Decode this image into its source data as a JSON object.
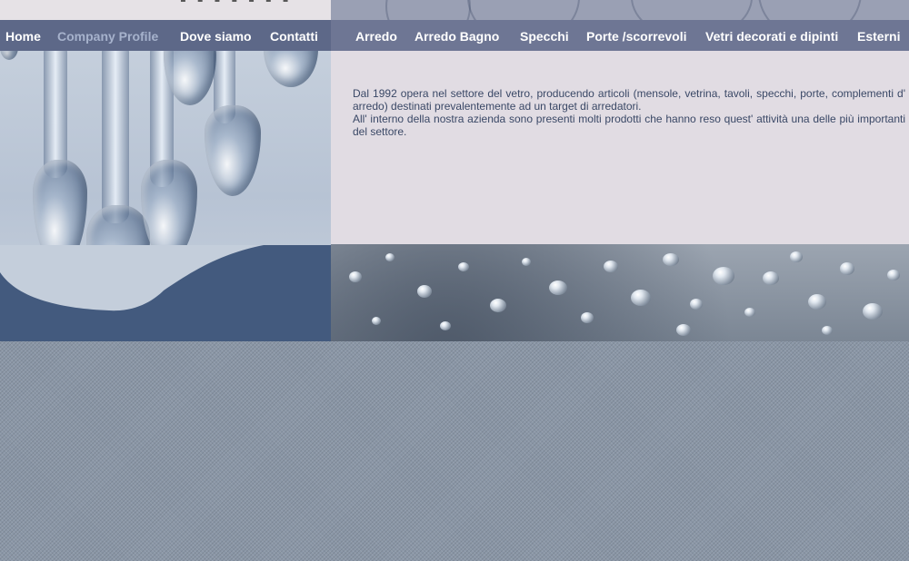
{
  "nav": {
    "left": [
      {
        "label": "Home",
        "current": false
      },
      {
        "label": "Company Profile",
        "current": true
      },
      {
        "label": "Dove siamo",
        "current": false
      },
      {
        "label": "Contatti",
        "current": false
      }
    ],
    "right": [
      {
        "label": "Arredo"
      },
      {
        "label": "Arredo Bagno"
      },
      {
        "label": "Specchi"
      },
      {
        "label": "Porte /scorrevoli"
      },
      {
        "label": "Vetri decorati e dipinti"
      },
      {
        "label": "Esterni"
      }
    ]
  },
  "intro": {
    "paragraph1": "Dal 1992 opera nel settore del vetro, producendo articoli (mensole, vetrina, tavoli, specchi, porte, complementi d' arredo) destinati prevalentemente ad un target di arredatori.",
    "paragraph2": "All' interno della nostra azienda sono presenti molti prodotti che hanno reso quest' attività una delle più importanti del settore."
  },
  "colors": {
    "nav_left_bg": "#5d6888",
    "nav_right_bg": "#6e7694",
    "nav_text": "#ffffff",
    "nav_current_text": "#a6b2cc",
    "text_panel_bg": "#e1dce3",
    "body_text": "#3a4866",
    "hero_band": "#435a7e"
  }
}
